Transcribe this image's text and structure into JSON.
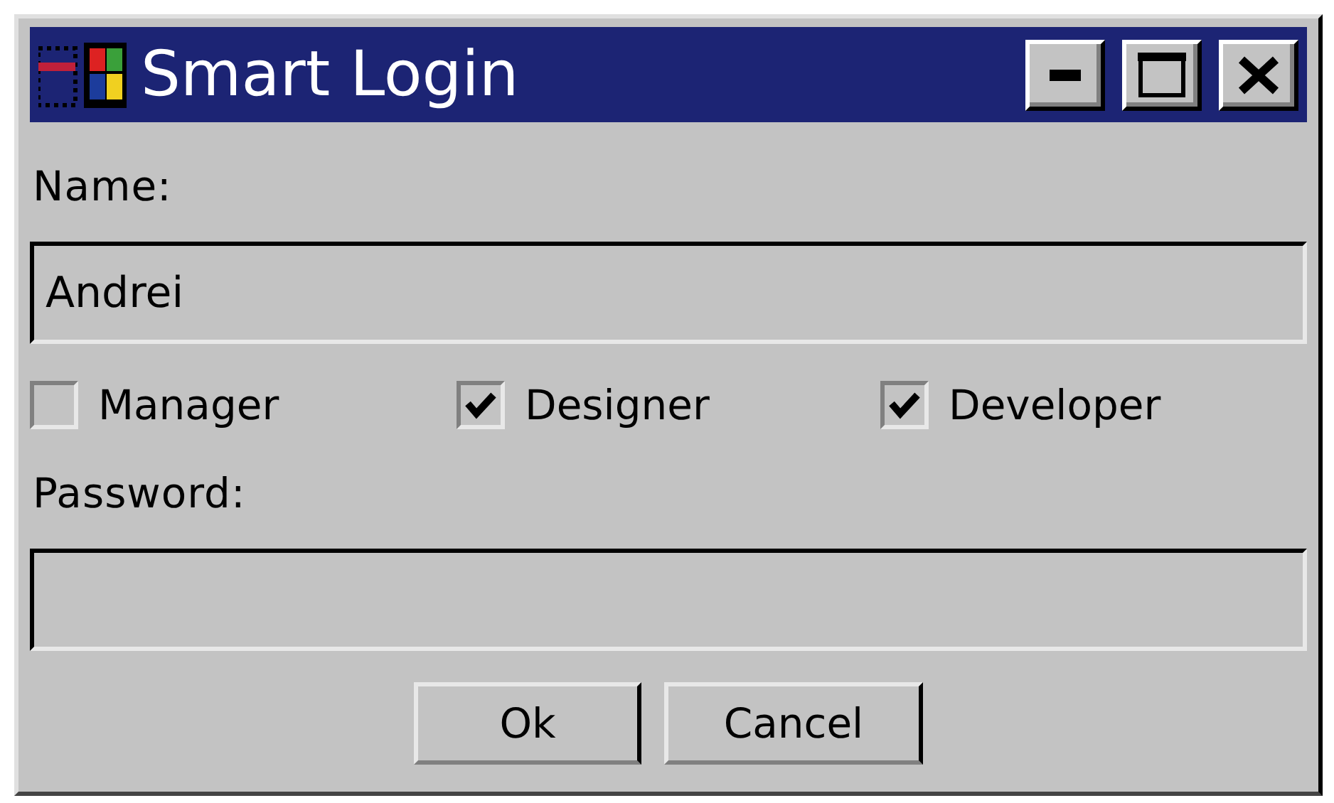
{
  "window": {
    "title": "Smart Login"
  },
  "title_buttons": [
    {
      "kind": "minimize"
    },
    {
      "kind": "maximize"
    },
    {
      "kind": "close"
    }
  ],
  "name": {
    "label": "Name:",
    "value": "Andrei"
  },
  "roles": [
    {
      "label": "Manager",
      "checked": false
    },
    {
      "label": "Designer",
      "checked": true
    },
    {
      "label": "Developer",
      "checked": true
    }
  ],
  "password": {
    "label": "Password:"
  },
  "buttons": [
    "Ok",
    "Cancel"
  ]
}
